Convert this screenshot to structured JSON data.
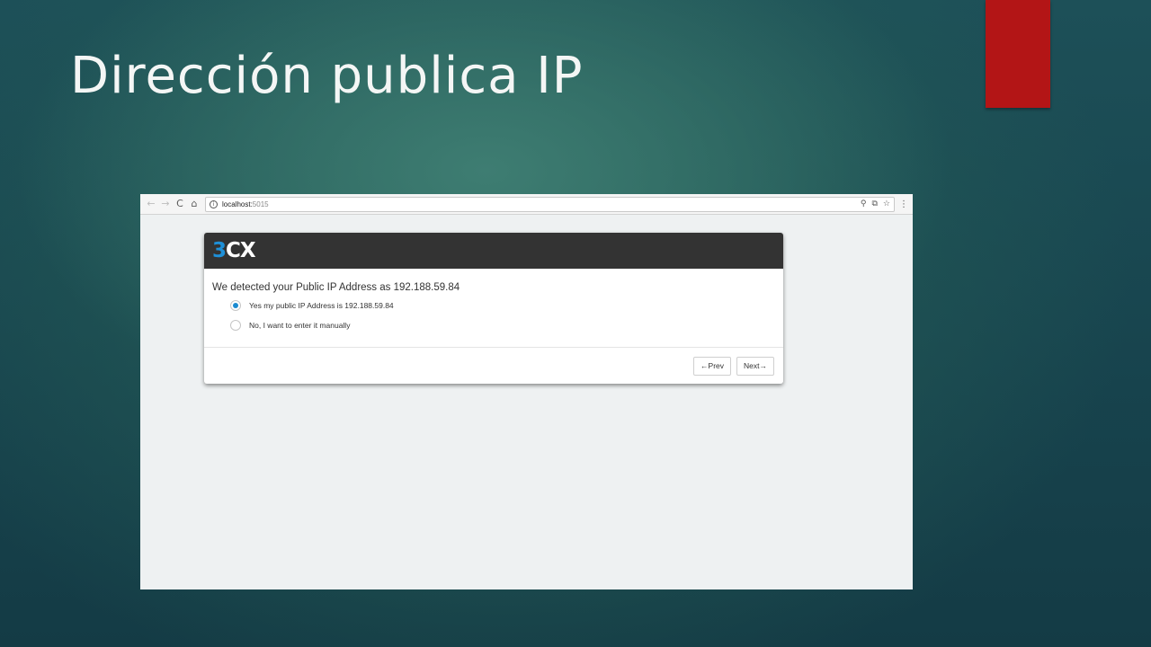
{
  "slide": {
    "title": "Dirección publica IP"
  },
  "colors": {
    "accent_bar": "#b31516",
    "background": "#1d5058",
    "brand_blue": "#1e90d8",
    "header": "#333333"
  },
  "browser": {
    "back_icon": "←",
    "forward_icon": "→",
    "reload_icon": "C",
    "home_icon": "⌂",
    "info_icon": "i",
    "url_host": "localhost:",
    "url_port": "5015",
    "icons": [
      "key-icon",
      "translate-icon",
      "star-icon",
      "menu-icon"
    ],
    "key_icon": "⚲",
    "translate_icon": "⧉",
    "star_icon": "☆",
    "menu_icon": "⋮"
  },
  "wizard": {
    "logo_number": "3",
    "logo_letters": "CX",
    "heading": "We detected your Public IP Address as 192.188.59.84",
    "options": [
      {
        "label": "Yes my public IP Address is 192.188.59.84",
        "selected": true
      },
      {
        "label": "No, I want to enter it manually",
        "selected": false
      }
    ],
    "prev_label": "←Prev",
    "next_label": "Next→"
  }
}
